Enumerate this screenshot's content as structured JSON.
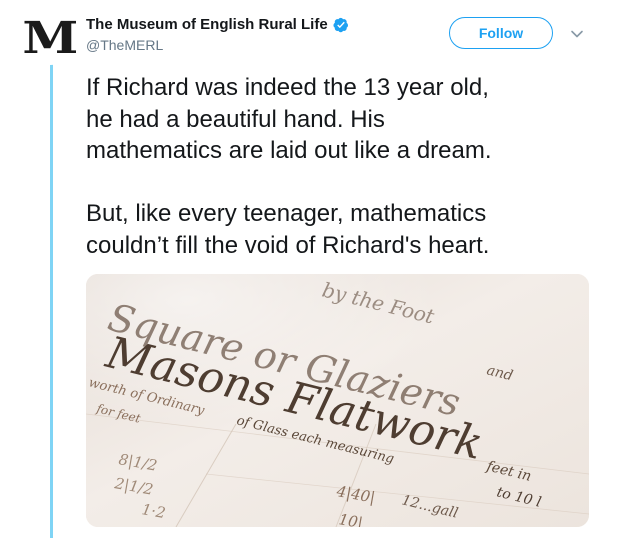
{
  "tweet": {
    "display_name": "The Museum of English Rural Life",
    "handle": "@TheMERL",
    "avatar_letter": "M",
    "follow_label": "Follow",
    "text": "If Richard was indeed the 13 year old,\nhe had a beautiful hand. His\nmathematics are laid out like a dream.\n\nBut, like every teenager, mathematics\ncouldn’t fill the void of Richard's heart.",
    "icons": {
      "verified": "verified-badge-icon",
      "chevron": "chevron-down-icon"
    },
    "colors": {
      "accent": "#1da1f2",
      "thread_line": "#7fd4f5",
      "handle": "#657786"
    }
  },
  "media": {
    "lines": {
      "line1": "Square or Glaziers",
      "line2": "Masons Flatwork",
      "line3": "and",
      "line4": "worth of Ordinary",
      "line5": "of Glass each measuring",
      "line6": "feet in",
      "line7": "to 10 l",
      "line8": "for feet",
      "line9": "by the Foot",
      "frac1": "8|1/2",
      "frac2": "2|1/2",
      "frac3": "1·2",
      "frac4": "4|40|",
      "frac5": "12...gall",
      "frac6": "10|"
    }
  }
}
